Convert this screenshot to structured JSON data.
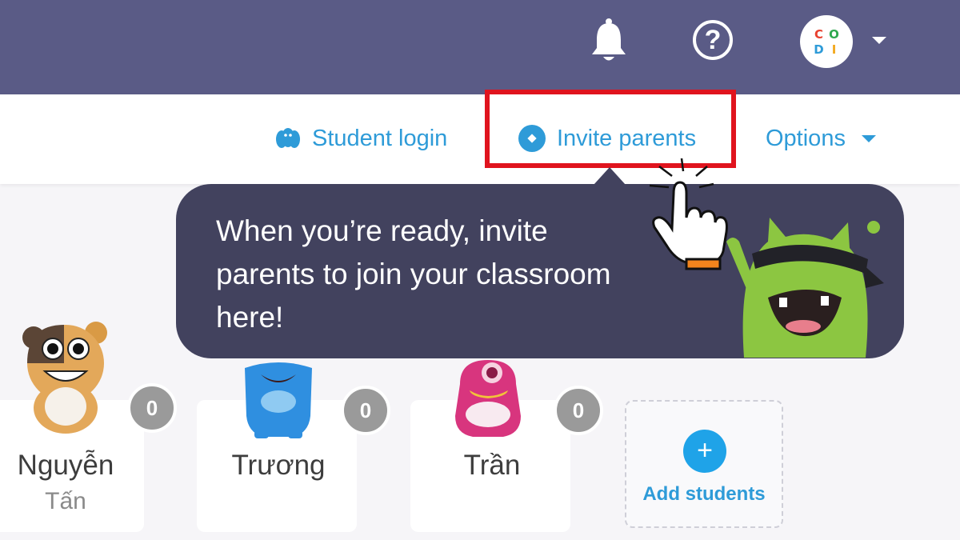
{
  "header": {
    "avatar_letters": [
      "C",
      "O",
      "D",
      "I"
    ],
    "avatar_letter_colors": [
      "#e8412f",
      "#2fa84f",
      "#2e9bd8",
      "#f2a81d"
    ]
  },
  "nav": {
    "student_login": "Student login",
    "invite_parents": "Invite parents",
    "options": "Options"
  },
  "tooltip": {
    "lines": [
      "When you’re ready, invite",
      "parents to join your classroom",
      "here!"
    ]
  },
  "students": [
    {
      "first": "Nguyễn",
      "second": "Tấn",
      "points": "0"
    },
    {
      "first": "Trương",
      "points": "0"
    },
    {
      "first": "Trần",
      "points": "0"
    }
  ],
  "add_students": {
    "label": "Add students",
    "icon": "+"
  },
  "colors": {
    "header_bg": "#5a5b86",
    "accent_blue": "#2e9bd8",
    "tooltip_bg": "#42425e",
    "highlight_red": "#e0141e",
    "badge_gray": "#9a9a9a"
  }
}
